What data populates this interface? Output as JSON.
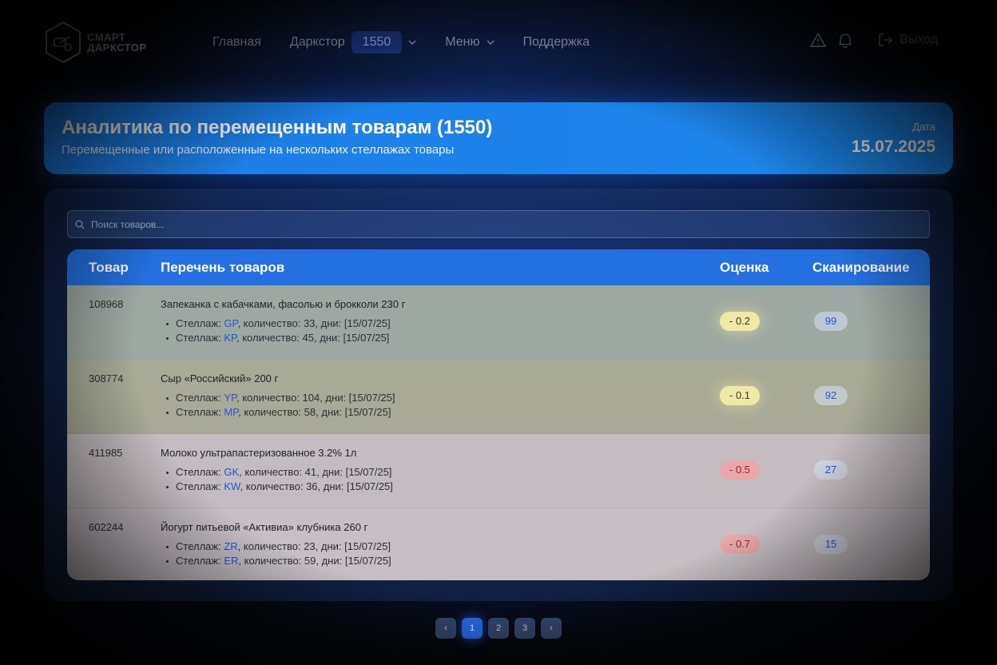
{
  "brand": {
    "line1": "СМАРТ",
    "line2": "ДАРКСТОР"
  },
  "nav": {
    "home": "Главная",
    "darkstore": "Даркстор",
    "darkstore_id": "1550",
    "menu": "Меню",
    "support": "Поддержка",
    "logout": "Выход"
  },
  "header": {
    "title": "Аналитика по перемещенным товарам (1550)",
    "subtitle": "Перемещенные или расположенные на нескольких стеллажах товары",
    "date_label": "Дата",
    "date": "15.07.2025"
  },
  "search": {
    "placeholder": "Поиск товаров..."
  },
  "table": {
    "columns": [
      "Товар",
      "Перечень товаров",
      "Оценка",
      "Сканирование"
    ],
    "shelf_prefix": "Стеллаж: ",
    "rows": [
      {
        "id": "108968",
        "name": "Запеканка с кабачками, фасолью и брокколи 230 г",
        "shelves": [
          {
            "code": "GP",
            "rest": ", количество: 33, дни: [15/07/25]"
          },
          {
            "code": "KP",
            "rest": ", количество: 45, дни: [15/07/25]"
          }
        ],
        "score": "- 0.2",
        "scan": "99"
      },
      {
        "id": "308774",
        "name": "Сыр «Российский» 200 г",
        "shelves": [
          {
            "code": "YP",
            "rest": ", количество: 104, дни: [15/07/25]"
          },
          {
            "code": "MP",
            "rest": ", количество: 58, дни: [15/07/25]"
          }
        ],
        "score": "- 0.1",
        "scan": "92"
      },
      {
        "id": "411985",
        "name": "Молоко ультрапастеризованное 3.2% 1л",
        "shelves": [
          {
            "code": "GK",
            "rest": ", количество: 41, дни: [15/07/25]"
          },
          {
            "code": "KW",
            "rest": ", количество: 36, дни: [15/07/25]"
          }
        ],
        "score": "- 0.5",
        "scan": "27"
      },
      {
        "id": "602244",
        "name": "Йогурт питьевой «Активиа» клубника 260 г",
        "shelves": [
          {
            "code": "ZR",
            "rest": ", количество: 23, дни: [15/07/25]"
          },
          {
            "code": "ER",
            "rest": ", количество: 59, дни: [15/07/25]"
          }
        ],
        "score": "- 0.7",
        "scan": "15"
      }
    ]
  },
  "pagination": {
    "prev": "‹",
    "pages": [
      "1",
      "2",
      "3"
    ],
    "next": "›",
    "current": "1"
  },
  "colors": {
    "accent": "#2470e0",
    "score_warn": "#efe9a8",
    "score_bad": "#e8a7a9",
    "link": "#2356d8"
  }
}
